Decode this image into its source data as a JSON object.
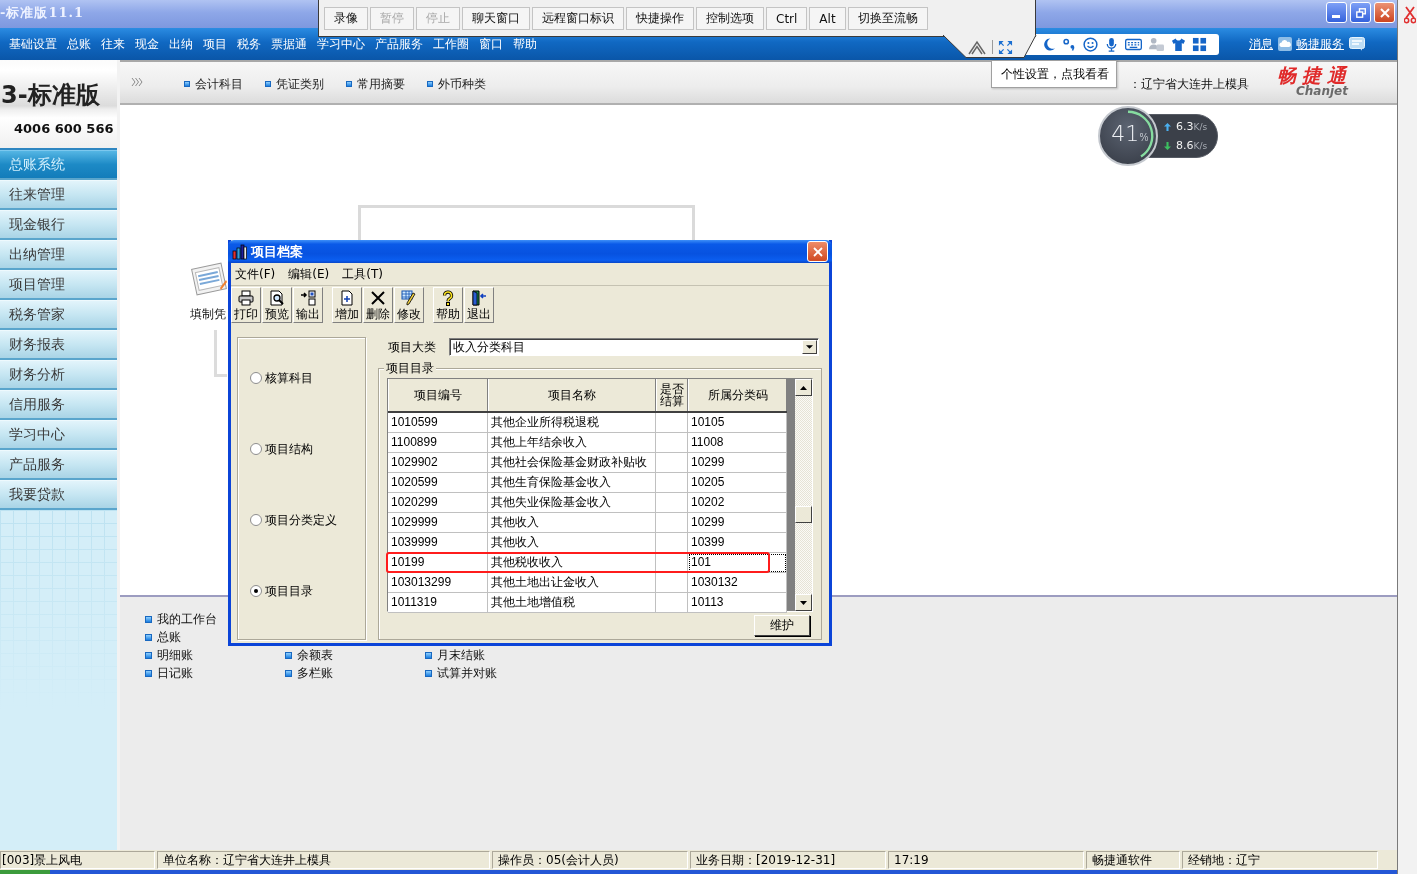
{
  "window": {
    "title": "-标准版11.1"
  },
  "remote_toolbar": {
    "buttons": [
      {
        "label": "录像",
        "disabled": false
      },
      {
        "label": "暂停",
        "disabled": true
      },
      {
        "label": "停止",
        "disabled": true
      },
      {
        "label": "聊天窗口",
        "disabled": false
      },
      {
        "label": "远程窗口标识",
        "disabled": false
      },
      {
        "label": "快捷操作",
        "disabled": false
      },
      {
        "label": "控制选项",
        "disabled": false
      },
      {
        "label": "Ctrl",
        "disabled": false
      },
      {
        "label": "Alt",
        "disabled": false
      },
      {
        "label": "切换至流畅",
        "disabled": false
      }
    ]
  },
  "menu_bar": {
    "items": [
      "基础设置",
      "总账",
      "往来",
      "现金",
      "出纳",
      "项目",
      "税务",
      "票据通",
      "学习中心",
      "产品服务",
      "工作圈",
      "窗口",
      "帮助"
    ],
    "links": [
      "消息",
      "畅捷服务"
    ]
  },
  "tooltip": {
    "text": "个性设置，点我看看"
  },
  "brand": {
    "product": "3-标准版",
    "phone": "4006 600 566"
  },
  "sidebar": {
    "items": [
      {
        "label": "总账系统",
        "selected": true
      },
      {
        "label": "往来管理",
        "selected": false
      },
      {
        "label": "现金银行",
        "selected": false
      },
      {
        "label": "出纳管理",
        "selected": false
      },
      {
        "label": "项目管理",
        "selected": false
      },
      {
        "label": "税务管家",
        "selected": false
      },
      {
        "label": "财务报表",
        "selected": false
      },
      {
        "label": "财务分析",
        "selected": false
      },
      {
        "label": "信用服务",
        "selected": false
      },
      {
        "label": "学习中心",
        "selected": false
      },
      {
        "label": "产品服务",
        "selected": false
      },
      {
        "label": "我要贷款",
        "selected": false
      }
    ]
  },
  "quick_bar": {
    "items": [
      "会计科目",
      "凭证类别",
      "常用摘要",
      "外币种类"
    ],
    "account_set": "：辽宁省大连井上模具",
    "logo": {
      "name": "畅捷通",
      "latin": "Chanjet"
    }
  },
  "workflow": {
    "tile_label": "填制凭"
  },
  "speed_meter": {
    "usage": {
      "value": "41",
      "unit": "%",
      "level": 0.41
    },
    "upload": {
      "value": "6.3",
      "unit": "K/s"
    },
    "download": {
      "value": "8.6",
      "unit": "K/s"
    }
  },
  "shortcuts": {
    "columns": [
      [
        "我的工作台",
        "总账",
        "明细账",
        "日记账"
      ],
      [
        "余额表",
        "多栏账"
      ],
      [
        "月末结账",
        "试算并对账"
      ]
    ]
  },
  "dialog": {
    "title": "项目档案",
    "menu": [
      "文件(F)",
      "编辑(E)",
      "工具(T)"
    ],
    "toolbar_groups": [
      [
        "打印",
        "预览",
        "输出"
      ],
      [
        "增加",
        "删除",
        "修改"
      ],
      [
        "帮助",
        "退出"
      ]
    ],
    "radios": [
      {
        "label": "核算科目",
        "selected": false
      },
      {
        "label": "项目结构",
        "selected": false
      },
      {
        "label": "项目分类定义",
        "selected": false
      },
      {
        "label": "项目目录",
        "selected": true
      }
    ],
    "category": {
      "label": "项目大类",
      "value": "收入分类科目"
    },
    "group_title": "项目目录",
    "table": {
      "columns": [
        "项目编号",
        "项目名称",
        "是否结算",
        "所属分类码"
      ],
      "rows": [
        {
          "code": "1010599",
          "name": "其他企业所得税退税",
          "category": "10105",
          "marked": false,
          "focused": false
        },
        {
          "code": "1100899",
          "name": "其他上年结余收入",
          "category": "11008",
          "marked": false,
          "focused": false
        },
        {
          "code": "1029902",
          "name": "其他社会保险基金财政补贴收",
          "category": "10299",
          "marked": false,
          "focused": false
        },
        {
          "code": "1020599",
          "name": "其他生育保险基金收入",
          "category": "10205",
          "marked": false,
          "focused": false
        },
        {
          "code": "1020299",
          "name": "其他失业保险基金收入",
          "category": "10202",
          "marked": false,
          "focused": false
        },
        {
          "code": "1029999",
          "name": "其他收入",
          "category": "10299",
          "marked": false,
          "focused": false
        },
        {
          "code": "1039999",
          "name": "其他收入",
          "category": "10399",
          "marked": false,
          "focused": false
        },
        {
          "code": "10199",
          "name": "其他税收收入",
          "category": "101",
          "marked": true,
          "focused": true
        },
        {
          "code": "103013299",
          "name": "其他土地出让金收入",
          "category": "1030132",
          "marked": false,
          "focused": false
        },
        {
          "code": "1011319",
          "name": "其他土地增值税",
          "category": "10113",
          "marked": false,
          "focused": false
        }
      ]
    },
    "buttons": [
      "维护"
    ]
  },
  "status_bar": {
    "cells": [
      "[003]景上风电",
      "单位名称：辽宁省大连井上模具",
      "操作员：05(会计人员)",
      "业务日期：[2019-12-31]",
      "17:19",
      "畅捷通软件",
      "经销地：辽宁"
    ]
  }
}
